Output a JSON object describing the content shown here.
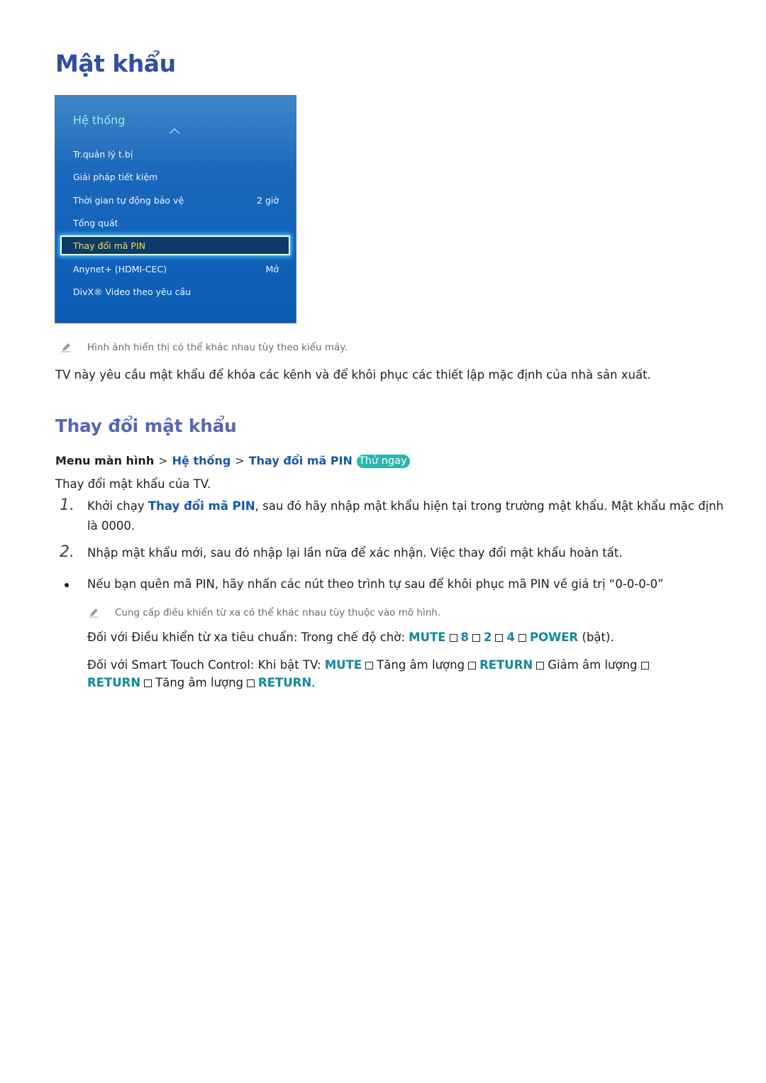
{
  "page": {
    "title": "Mật khẩu"
  },
  "tv_menu": {
    "title": "Hệ thống",
    "items": [
      {
        "label": "Tr.quản lý t.bị",
        "value": ""
      },
      {
        "label": "Giải pháp tiết kiệm",
        "value": ""
      },
      {
        "label": "Thời gian tự động bảo vệ",
        "value": "2 giờ"
      },
      {
        "label": "Tổng quát",
        "value": ""
      },
      {
        "label": "Thay đổi mã PIN",
        "value": "",
        "selected": true
      },
      {
        "label": "Anynet+ (HDMI-CEC)",
        "value": "Mở"
      },
      {
        "label": "DivX® Video theo yêu cầu",
        "value": ""
      }
    ],
    "colors": {
      "title": "#8ff0e3",
      "selected_text": "#f0e23c",
      "selected_bg": "#0b3a6b",
      "background": "#0a5cb5"
    }
  },
  "notes": {
    "image_note": "Hình ảnh hiển thị có thể khác nhau tùy theo kiểu máy.",
    "remote_note": "Cung cấp điều khiển từ xa có thể khác nhau tùy thuộc vào mô hình."
  },
  "intro": "TV này yêu cầu mật khẩu để khóa các kênh và để khôi phục các thiết lập mặc định của nhà sản xuất.",
  "section": {
    "title": "Thay đổi mật khẩu",
    "breadcrumb": {
      "root": "Menu màn hình",
      "sep": ">",
      "level1": "Hệ thống",
      "level2": "Thay đổi mã PIN",
      "badge": "Thử ngay"
    },
    "description": "Thay đổi mật khẩu của TV.",
    "steps": [
      {
        "number": "1.",
        "pre": "Khởi chạy ",
        "link": "Thay đổi mã PIN",
        "post": ", sau đó hãy nhập mật khẩu hiện tại trong trường mật khẩu. Mật khẩu mặc định",
        "line2": "là 0000."
      },
      {
        "number": "2.",
        "text": "Nhập mật khẩu mới, sau đó nhập lại lần nữa để xác nhận. Việc thay đổi mật khẩu hoàn tất."
      }
    ],
    "bullet": "Nếu bạn quên mã PIN, hãy nhấn các nút theo trình tự sau để khôi phục mã PIN về giá trị “0-0-0-0”",
    "standard_remote": {
      "prefix": "Đối với Điều khiển từ xa tiêu chuẩn: Trong chế độ chờ: ",
      "keys": [
        "MUTE",
        "8",
        "2",
        "4",
        "POWER"
      ],
      "suffix": " (bật)."
    },
    "smart_touch": {
      "prefix": "Đối với Smart Touch Control: Khi bật TV: ",
      "key_mute": "MUTE",
      "vol_up": "Tăng âm lượng",
      "key_return": "RETURN",
      "vol_down": "Giảm âm lượng",
      "end": "."
    }
  },
  "colors": {
    "title": "#2f4fa3",
    "section_title": "#5565b8",
    "link": "#1558a8",
    "key": "#10899c",
    "badge": "#2bb3ad"
  }
}
